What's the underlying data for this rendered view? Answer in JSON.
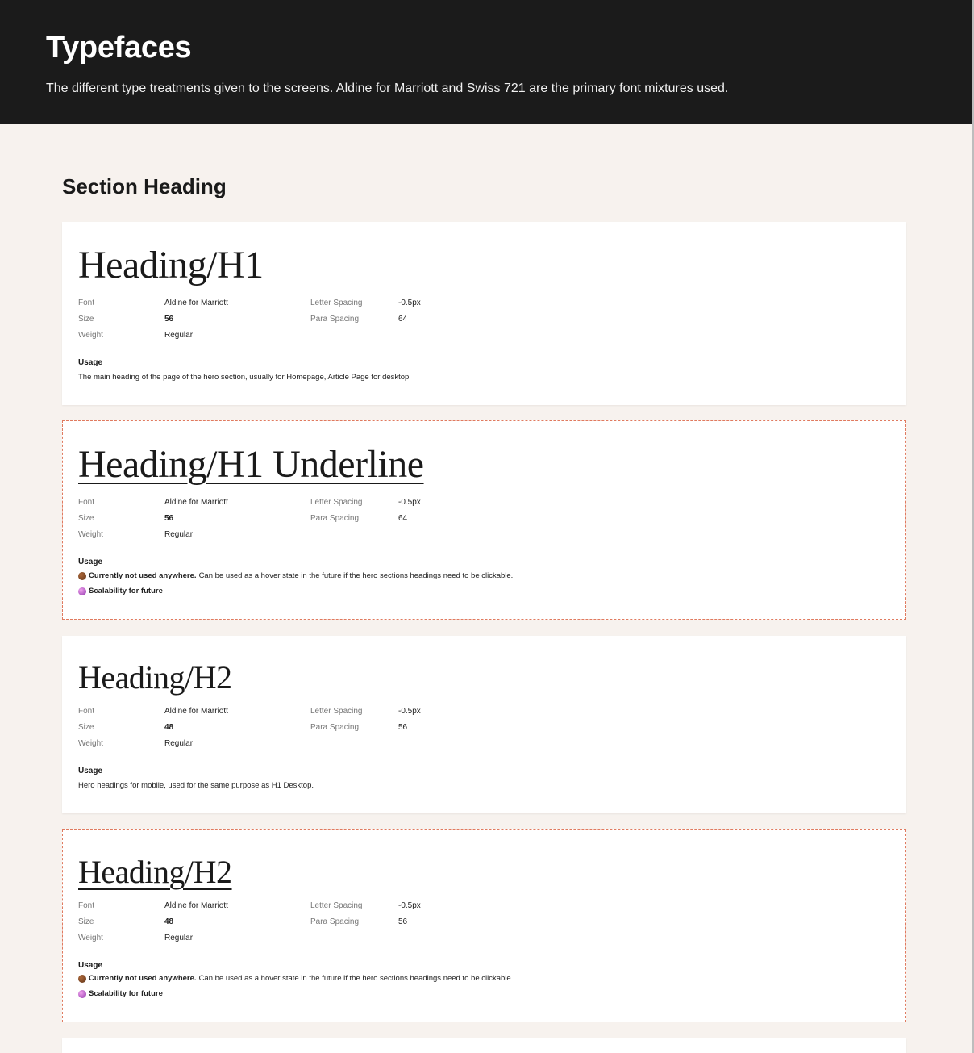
{
  "header": {
    "title": "Typefaces",
    "subtitle": "The different type treatments given to the screens. Aldine for Marriott and Swiss 721 are the primary font mixtures used."
  },
  "section": {
    "heading": "Section Heading"
  },
  "labels": {
    "font": "Font",
    "size": "Size",
    "weight": "Weight",
    "letter_spacing": "Letter Spacing",
    "para_spacing": "Para Spacing",
    "usage": "Usage"
  },
  "cards": [
    {
      "title": "Heading/H1",
      "font": "Aldine for Marriott",
      "size": "56",
      "weight": "Regular",
      "letter_spacing": "-0.5px",
      "para_spacing": "64",
      "usage": "The main heading of the page of the hero section, usually for Homepage, Article Page for desktop"
    },
    {
      "title": "Heading/H1 Underline",
      "font": "Aldine for Marriott",
      "size": "56",
      "weight": "Regular",
      "letter_spacing": "-0.5px",
      "para_spacing": "64",
      "usage_bold": "Currently not used anywhere.",
      "usage_rest": "Can be used as a hover state in the future if the hero sections headings need to be clickable.",
      "usage_note": "Scalability for future"
    },
    {
      "title": "Heading/H2",
      "font": "Aldine for Marriott",
      "size": "48",
      "weight": "Regular",
      "letter_spacing": "-0.5px",
      "para_spacing": "56",
      "usage": "Hero headings for mobile, used for the same purpose as H1 Desktop."
    },
    {
      "title": "Heading/H2",
      "font": "Aldine for Marriott",
      "size": "48",
      "weight": "Regular",
      "letter_spacing": "-0.5px",
      "para_spacing": "56",
      "usage_bold": "Currently not used anywhere.",
      "usage_rest": "Can be used as a hover state in the future if the hero sections headings need to be clickable.",
      "usage_note": "Scalability for future"
    }
  ],
  "colors": {
    "header_bg": "#1b1b1b",
    "page_bg": "#f7f2ee",
    "dashed_border": "#e07a5f"
  },
  "icons": {
    "brown_dot": "brown-circle-icon",
    "purple_dot": "purple-circle-icon"
  }
}
